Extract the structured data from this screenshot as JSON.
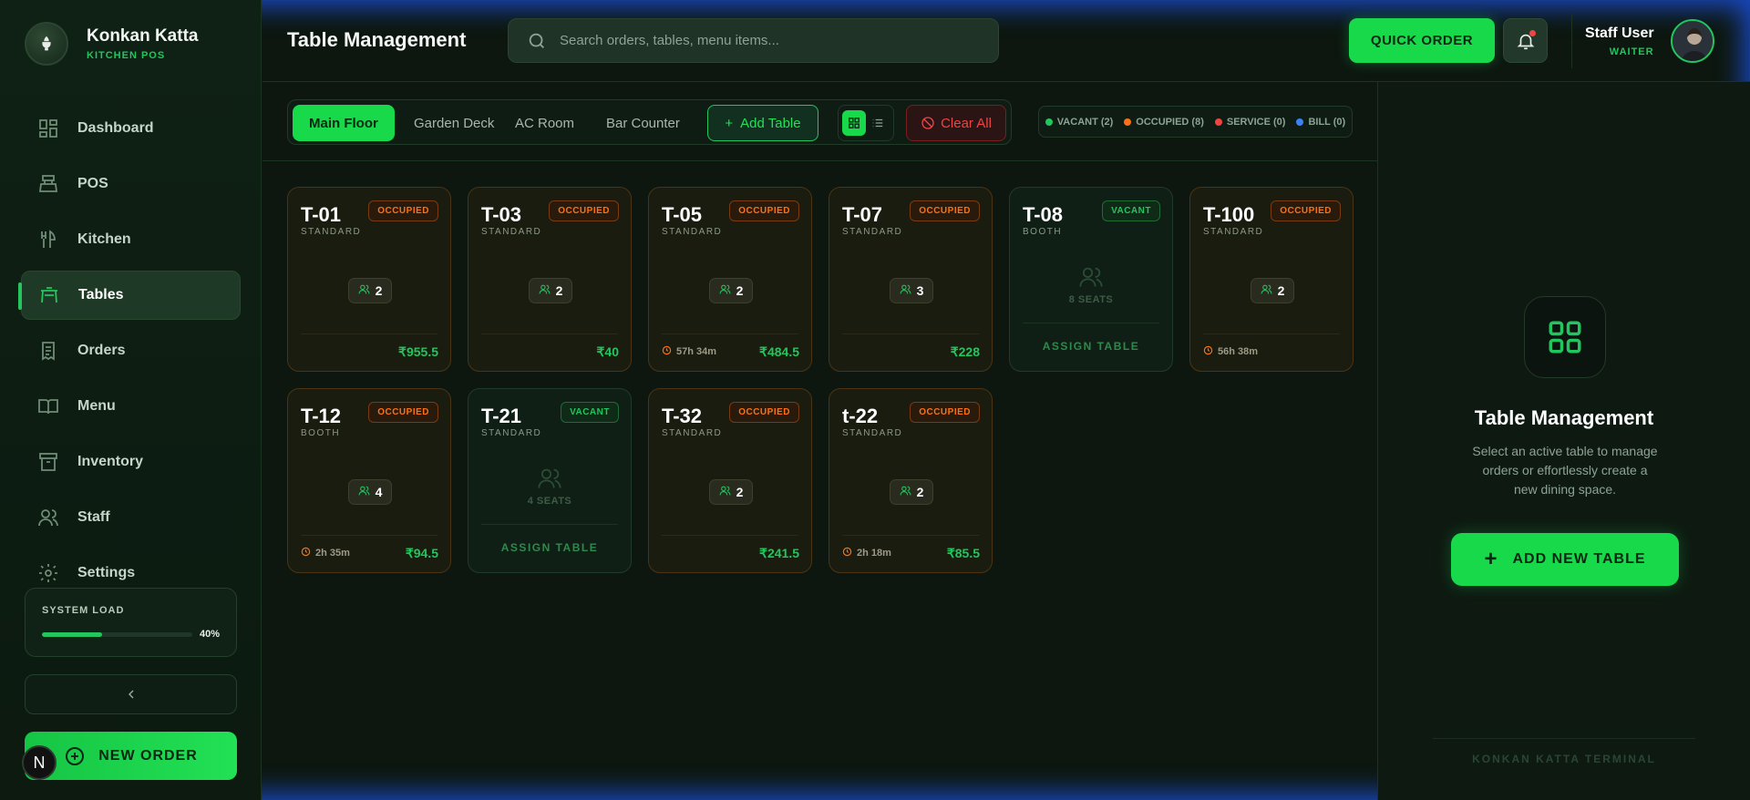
{
  "brand": {
    "name": "Konkan Katta",
    "subtitle": "KITCHEN POS"
  },
  "sidebar": {
    "items": [
      {
        "label": "Dashboard",
        "icon": "dashboard-icon"
      },
      {
        "label": "POS",
        "icon": "cash-register-icon"
      },
      {
        "label": "Kitchen",
        "icon": "chef-icon"
      },
      {
        "label": "Tables",
        "icon": "table-icon",
        "active": true
      },
      {
        "label": "Orders",
        "icon": "receipt-icon"
      },
      {
        "label": "Menu",
        "icon": "book-icon"
      },
      {
        "label": "Inventory",
        "icon": "archive-icon"
      },
      {
        "label": "Staff",
        "icon": "users-icon"
      },
      {
        "label": "Settings",
        "icon": "gear-icon"
      }
    ],
    "system_load": {
      "label": "SYSTEM LOAD",
      "value_text": "40%",
      "fraction": 0.4
    },
    "new_order_label": "NEW ORDER",
    "badge_letter": "N"
  },
  "header": {
    "title": "Table Management",
    "search_placeholder": "Search orders, tables, menu items...",
    "quick_order_label": "QUICK ORDER",
    "user": {
      "name": "Staff User",
      "role": "WAITER"
    }
  },
  "toolbar": {
    "tabs": [
      "Main Floor",
      "Garden Deck",
      "AC Room",
      "Bar Counter"
    ],
    "active_tab": "Main Floor",
    "add_table_label": "Add Table",
    "clear_all_label": "Clear All"
  },
  "legend": [
    {
      "label": "VACANT (2)",
      "color": "#22c55e"
    },
    {
      "label": "OCCUPIED (8)",
      "color": "#f97316"
    },
    {
      "label": "SERVICE (0)",
      "color": "#ef4444"
    },
    {
      "label": "BILL (0)",
      "color": "#3b82f6"
    }
  ],
  "tables": [
    {
      "id": "T-01",
      "type": "STANDARD",
      "status": "OCCUPIED",
      "guests": "2",
      "amount": "₹955.5",
      "time": ""
    },
    {
      "id": "T-03",
      "type": "STANDARD",
      "status": "OCCUPIED",
      "guests": "2",
      "amount": "₹40",
      "time": ""
    },
    {
      "id": "T-05",
      "type": "STANDARD",
      "status": "OCCUPIED",
      "guests": "2",
      "amount": "₹484.5",
      "time": "57h 34m"
    },
    {
      "id": "T-07",
      "type": "STANDARD",
      "status": "OCCUPIED",
      "guests": "3",
      "amount": "₹228",
      "time": ""
    },
    {
      "id": "T-08",
      "type": "BOOTH",
      "status": "VACANT",
      "seats": "8 SEATS",
      "assign": "ASSIGN TABLE"
    },
    {
      "id": "T-100",
      "type": "STANDARD",
      "status": "OCCUPIED",
      "guests": "2",
      "amount": "",
      "time": "56h 38m"
    },
    {
      "id": "T-12",
      "type": "BOOTH",
      "status": "OCCUPIED",
      "guests": "4",
      "amount": "₹94.5",
      "time": "2h 35m"
    },
    {
      "id": "T-21",
      "type": "STANDARD",
      "status": "VACANT",
      "seats": "4 SEATS",
      "assign": "ASSIGN TABLE"
    },
    {
      "id": "T-32",
      "type": "STANDARD",
      "status": "OCCUPIED",
      "guests": "2",
      "amount": "₹241.5",
      "time": ""
    },
    {
      "id": "t-22",
      "type": "STANDARD",
      "status": "OCCUPIED",
      "guests": "2",
      "amount": "₹85.5",
      "time": "2h 18m"
    }
  ],
  "right_panel": {
    "title": "Table Management",
    "description": "Select an active table to manage orders or effortlessly create a new dining space.",
    "button_label": "ADD NEW TABLE",
    "footer": "KONKAN KATTA TERMINAL"
  },
  "colors": {
    "accent": "#22c55e",
    "occupied": "#f97316",
    "danger": "#ef4444"
  }
}
